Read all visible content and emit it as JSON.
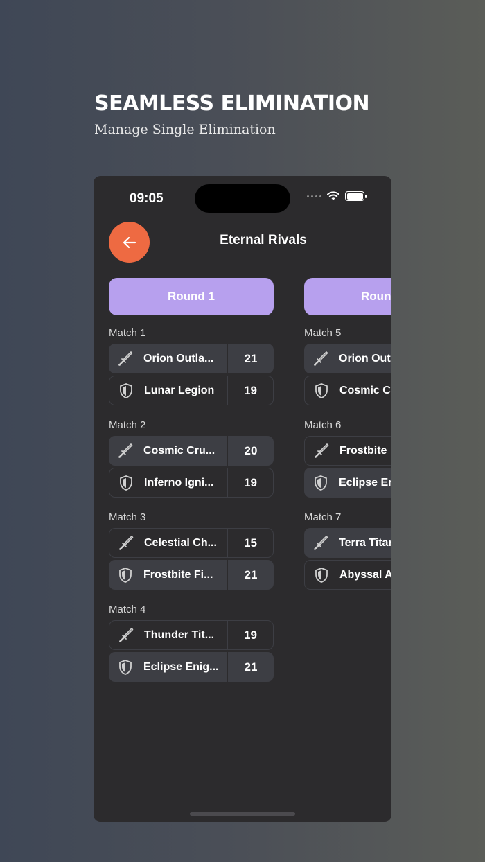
{
  "promo": {
    "title": "SEAMLESS ELIMINATION",
    "subtitle": "Manage Single Elimination"
  },
  "status_bar": {
    "time": "09:05"
  },
  "header": {
    "title": "Eternal Rivals"
  },
  "rounds": [
    {
      "label": "Round 1",
      "matches": [
        {
          "label": "Match 1",
          "teams": [
            {
              "name": "Orion Outla...",
              "score": "21",
              "icon": "sword-icon",
              "winner": true
            },
            {
              "name": "Lunar Legion",
              "score": "19",
              "icon": "shield-icon",
              "winner": false
            }
          ]
        },
        {
          "label": "Match 2",
          "teams": [
            {
              "name": "Cosmic Cru...",
              "score": "20",
              "icon": "sword-icon",
              "winner": true
            },
            {
              "name": "Inferno Igni...",
              "score": "19",
              "icon": "shield-icon",
              "winner": false
            }
          ]
        },
        {
          "label": "Match 3",
          "teams": [
            {
              "name": "Celestial Ch...",
              "score": "15",
              "icon": "sword-icon",
              "winner": false
            },
            {
              "name": "Frostbite Fi...",
              "score": "21",
              "icon": "shield-icon",
              "winner": true
            }
          ]
        },
        {
          "label": "Match 4",
          "teams": [
            {
              "name": "Thunder Tit...",
              "score": "19",
              "icon": "sword-icon",
              "winner": false
            },
            {
              "name": "Eclipse Enig...",
              "score": "21",
              "icon": "shield-icon",
              "winner": true
            }
          ]
        }
      ]
    },
    {
      "label": "Roun",
      "matches": [
        {
          "label": "Match 5",
          "teams": [
            {
              "name": "Orion Out",
              "icon": "sword-icon",
              "winner": true
            },
            {
              "name": "Cosmic Cr",
              "icon": "shield-icon",
              "winner": false
            }
          ]
        },
        {
          "label": "Match 6",
          "teams": [
            {
              "name": "Frostbite",
              "icon": "sword-icon",
              "winner": false
            },
            {
              "name": "Eclipse Er",
              "icon": "shield-icon",
              "winner": true
            }
          ]
        },
        {
          "label": "Match 7",
          "teams": [
            {
              "name": "Terra Titar",
              "icon": "sword-icon",
              "winner": true
            },
            {
              "name": "Abyssal A",
              "icon": "shield-icon",
              "winner": false
            }
          ]
        }
      ]
    }
  ],
  "colors": {
    "accent_back": "#ee6a42",
    "round_button": "#b7a0ee",
    "card_winner": "#3d3e44",
    "phone_bg": "#2c2b2d"
  }
}
